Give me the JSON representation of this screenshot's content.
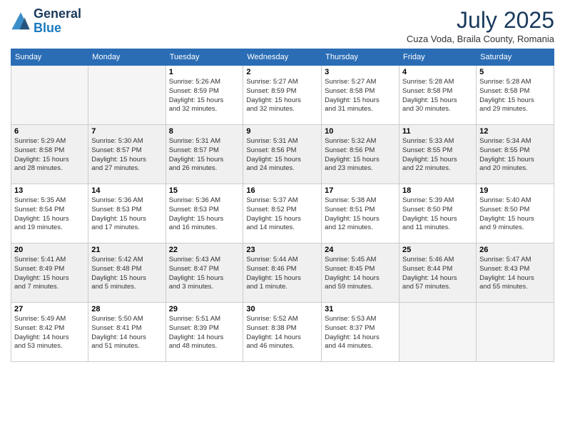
{
  "logo": {
    "line1": "General",
    "line2": "Blue"
  },
  "title": "July 2025",
  "subtitle": "Cuza Voda, Braila County, Romania",
  "weekdays": [
    "Sunday",
    "Monday",
    "Tuesday",
    "Wednesday",
    "Thursday",
    "Friday",
    "Saturday"
  ],
  "weeks": [
    [
      {
        "day": "",
        "info": ""
      },
      {
        "day": "",
        "info": ""
      },
      {
        "day": "1",
        "info": "Sunrise: 5:26 AM\nSunset: 8:59 PM\nDaylight: 15 hours\nand 32 minutes."
      },
      {
        "day": "2",
        "info": "Sunrise: 5:27 AM\nSunset: 8:59 PM\nDaylight: 15 hours\nand 32 minutes."
      },
      {
        "day": "3",
        "info": "Sunrise: 5:27 AM\nSunset: 8:58 PM\nDaylight: 15 hours\nand 31 minutes."
      },
      {
        "day": "4",
        "info": "Sunrise: 5:28 AM\nSunset: 8:58 PM\nDaylight: 15 hours\nand 30 minutes."
      },
      {
        "day": "5",
        "info": "Sunrise: 5:28 AM\nSunset: 8:58 PM\nDaylight: 15 hours\nand 29 minutes."
      }
    ],
    [
      {
        "day": "6",
        "info": "Sunrise: 5:29 AM\nSunset: 8:58 PM\nDaylight: 15 hours\nand 28 minutes."
      },
      {
        "day": "7",
        "info": "Sunrise: 5:30 AM\nSunset: 8:57 PM\nDaylight: 15 hours\nand 27 minutes."
      },
      {
        "day": "8",
        "info": "Sunrise: 5:31 AM\nSunset: 8:57 PM\nDaylight: 15 hours\nand 26 minutes."
      },
      {
        "day": "9",
        "info": "Sunrise: 5:31 AM\nSunset: 8:56 PM\nDaylight: 15 hours\nand 24 minutes."
      },
      {
        "day": "10",
        "info": "Sunrise: 5:32 AM\nSunset: 8:56 PM\nDaylight: 15 hours\nand 23 minutes."
      },
      {
        "day": "11",
        "info": "Sunrise: 5:33 AM\nSunset: 8:55 PM\nDaylight: 15 hours\nand 22 minutes."
      },
      {
        "day": "12",
        "info": "Sunrise: 5:34 AM\nSunset: 8:55 PM\nDaylight: 15 hours\nand 20 minutes."
      }
    ],
    [
      {
        "day": "13",
        "info": "Sunrise: 5:35 AM\nSunset: 8:54 PM\nDaylight: 15 hours\nand 19 minutes."
      },
      {
        "day": "14",
        "info": "Sunrise: 5:36 AM\nSunset: 8:53 PM\nDaylight: 15 hours\nand 17 minutes."
      },
      {
        "day": "15",
        "info": "Sunrise: 5:36 AM\nSunset: 8:53 PM\nDaylight: 15 hours\nand 16 minutes."
      },
      {
        "day": "16",
        "info": "Sunrise: 5:37 AM\nSunset: 8:52 PM\nDaylight: 15 hours\nand 14 minutes."
      },
      {
        "day": "17",
        "info": "Sunrise: 5:38 AM\nSunset: 8:51 PM\nDaylight: 15 hours\nand 12 minutes."
      },
      {
        "day": "18",
        "info": "Sunrise: 5:39 AM\nSunset: 8:50 PM\nDaylight: 15 hours\nand 11 minutes."
      },
      {
        "day": "19",
        "info": "Sunrise: 5:40 AM\nSunset: 8:50 PM\nDaylight: 15 hours\nand 9 minutes."
      }
    ],
    [
      {
        "day": "20",
        "info": "Sunrise: 5:41 AM\nSunset: 8:49 PM\nDaylight: 15 hours\nand 7 minutes."
      },
      {
        "day": "21",
        "info": "Sunrise: 5:42 AM\nSunset: 8:48 PM\nDaylight: 15 hours\nand 5 minutes."
      },
      {
        "day": "22",
        "info": "Sunrise: 5:43 AM\nSunset: 8:47 PM\nDaylight: 15 hours\nand 3 minutes."
      },
      {
        "day": "23",
        "info": "Sunrise: 5:44 AM\nSunset: 8:46 PM\nDaylight: 15 hours\nand 1 minute."
      },
      {
        "day": "24",
        "info": "Sunrise: 5:45 AM\nSunset: 8:45 PM\nDaylight: 14 hours\nand 59 minutes."
      },
      {
        "day": "25",
        "info": "Sunrise: 5:46 AM\nSunset: 8:44 PM\nDaylight: 14 hours\nand 57 minutes."
      },
      {
        "day": "26",
        "info": "Sunrise: 5:47 AM\nSunset: 8:43 PM\nDaylight: 14 hours\nand 55 minutes."
      }
    ],
    [
      {
        "day": "27",
        "info": "Sunrise: 5:49 AM\nSunset: 8:42 PM\nDaylight: 14 hours\nand 53 minutes."
      },
      {
        "day": "28",
        "info": "Sunrise: 5:50 AM\nSunset: 8:41 PM\nDaylight: 14 hours\nand 51 minutes."
      },
      {
        "day": "29",
        "info": "Sunrise: 5:51 AM\nSunset: 8:39 PM\nDaylight: 14 hours\nand 48 minutes."
      },
      {
        "day": "30",
        "info": "Sunrise: 5:52 AM\nSunset: 8:38 PM\nDaylight: 14 hours\nand 46 minutes."
      },
      {
        "day": "31",
        "info": "Sunrise: 5:53 AM\nSunset: 8:37 PM\nDaylight: 14 hours\nand 44 minutes."
      },
      {
        "day": "",
        "info": ""
      },
      {
        "day": "",
        "info": ""
      }
    ]
  ]
}
